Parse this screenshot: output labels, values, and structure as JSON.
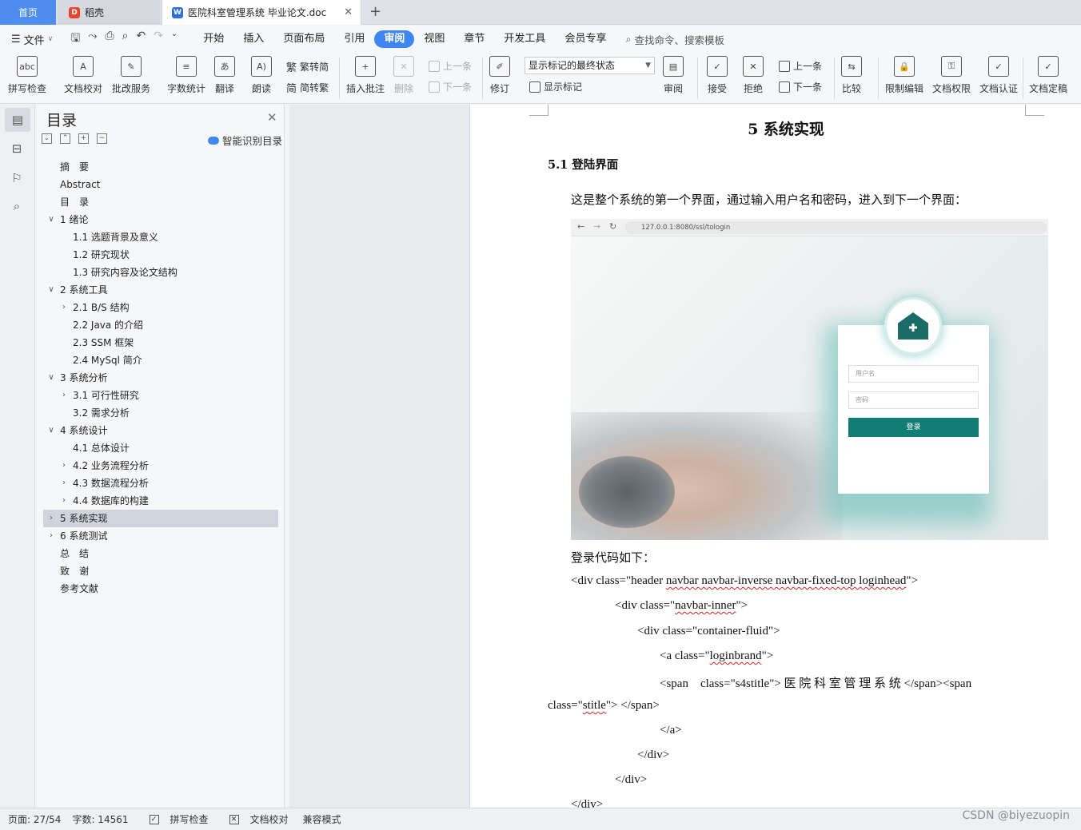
{
  "tabs": {
    "home": "首页",
    "daoke": "稻壳",
    "doc": "医院科室管理系统 毕业论文.doc"
  },
  "menubar": {
    "file": "文件",
    "items": [
      "开始",
      "插入",
      "页面布局",
      "引用",
      "审阅",
      "视图",
      "章节",
      "开发工具",
      "会员专享"
    ],
    "active": "审阅",
    "search": "查找命令、搜索模板"
  },
  "ribbon": {
    "spell_check": "拼写检查",
    "doc_proof": "文档校对",
    "correction_service": "批改服务",
    "word_count": "字数统计",
    "translate": "翻译",
    "read_aloud": "朗读",
    "trad_to_simp": "繁转简",
    "simp_to_trad": "简转繁",
    "insert_comment": "插入批注",
    "delete": "删除",
    "prev_comment": "上一条",
    "next_comment": "下一条",
    "track_changes": "修订",
    "display_mode": "显示标记的最终状态",
    "show_markup": "显示标记",
    "review": "审阅",
    "accept": "接受",
    "reject": "拒绝",
    "prev_change": "上一条",
    "next_change": "下一条",
    "compare": "比较",
    "restrict_edit": "限制编辑",
    "doc_permission": "文档权限",
    "doc_auth": "文档认证",
    "doc_finalize": "文档定稿"
  },
  "toc": {
    "title": "目录",
    "smart": "智能识别目录",
    "items": [
      {
        "label": "摘　要",
        "level": 1,
        "arrow": ""
      },
      {
        "label": "Abstract",
        "level": 1,
        "arrow": ""
      },
      {
        "label": "目　录",
        "level": 1,
        "arrow": ""
      },
      {
        "label": "1 绪论",
        "level": 1,
        "arrow": "v"
      },
      {
        "label": "1.1 选题背景及意义",
        "level": 2,
        "arrow": ""
      },
      {
        "label": "1.2 研究现状",
        "level": 2,
        "arrow": ""
      },
      {
        "label": "1.3 研究内容及论文结构",
        "level": 2,
        "arrow": ""
      },
      {
        "label": "2 系统工具",
        "level": 1,
        "arrow": "v"
      },
      {
        "label": "2.1 B/S 结构",
        "level": 2,
        "arrow": ">"
      },
      {
        "label": "2.2 Java 的介绍",
        "level": 2,
        "arrow": ""
      },
      {
        "label": "2.3 SSM 框架",
        "level": 2,
        "arrow": ""
      },
      {
        "label": "2.4 MySql 简介",
        "level": 2,
        "arrow": ""
      },
      {
        "label": "3 系统分析",
        "level": 1,
        "arrow": "v"
      },
      {
        "label": "3.1 可行性研究",
        "level": 2,
        "arrow": ">"
      },
      {
        "label": "3.2  需求分析",
        "level": 2,
        "arrow": ""
      },
      {
        "label": "4 系统设计",
        "level": 1,
        "arrow": "v"
      },
      {
        "label": "4.1  总体设计",
        "level": 2,
        "arrow": ""
      },
      {
        "label": "4.2  业务流程分析",
        "level": 2,
        "arrow": ">"
      },
      {
        "label": "4.3 数据流程分析",
        "level": 2,
        "arrow": ">"
      },
      {
        "label": "4.4 数据库的构建",
        "level": 2,
        "arrow": ">"
      },
      {
        "label": "5 系统实现",
        "level": 1,
        "arrow": ">",
        "selected": true
      },
      {
        "label": "6 系统测试",
        "level": 1,
        "arrow": ">"
      },
      {
        "label": "总　结",
        "level": 1,
        "arrow": ""
      },
      {
        "label": "致　谢",
        "level": 1,
        "arrow": ""
      },
      {
        "label": "参考文献",
        "level": 1,
        "arrow": ""
      }
    ]
  },
  "document": {
    "h1": "5 系统实现",
    "h2": "5.1 登陆界面",
    "para": "这是整个系统的第一个界面，通过输入用户名和密码，进入到下一个界面：",
    "screenshot": {
      "url": "127.0.0.1:8080/ssl/tologin",
      "username_placeholder": "用户名",
      "password_placeholder": "密码",
      "login_button": "登录"
    },
    "code_intro": "登录代码如下：",
    "code": {
      "l1a": "<div class=\"header ",
      "l1b": "navbar navbar-inverse navbar-fixed-top loginhead",
      "l1c": "\">",
      "l2a": "<div class=\"",
      "l2b": "navbar-inner",
      "l2c": "\">",
      "l3": "<div class=\"container-fluid\">",
      "l4a": "<a class=\"",
      "l4b": "loginbrand",
      "l4c": "\">",
      "l5a": "<span　class=\"s4stitle\">",
      "l5b": "医 院 科 室 管 理 系 统",
      "l5c": "</span><span",
      "l6a": "class=\"",
      "l6b": "stitle",
      "l6c": "\"> </span>",
      "l7": "</a>",
      "l8": "</div>",
      "l9": "</div>",
      "l10": "</div>"
    }
  },
  "status": {
    "page": "页面: 27/54",
    "words": "字数: 14561",
    "spell": "拼写检查",
    "proof": "文档校对",
    "compat": "兼容模式"
  },
  "watermark": "CSDN @biyezuopin"
}
